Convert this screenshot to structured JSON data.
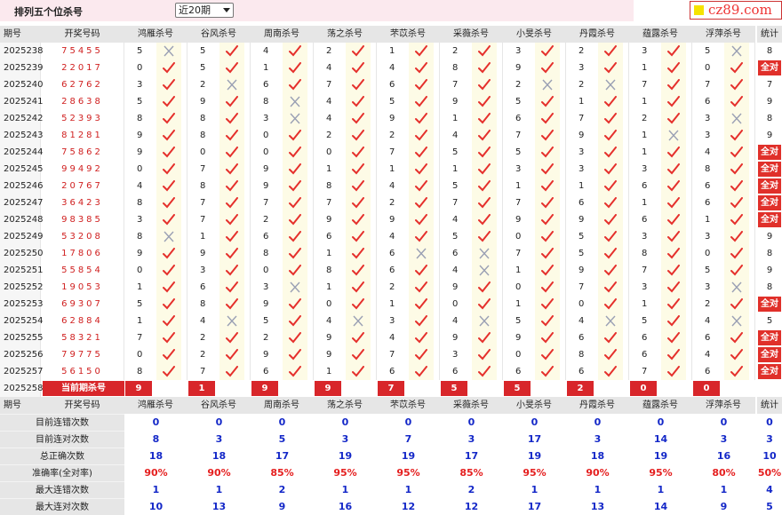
{
  "header": {
    "title": "排列五个位杀号",
    "period_select": "近20期",
    "logo": "cz89.com"
  },
  "columns": {
    "issue": "期号",
    "draw": "开奖号码",
    "killers": [
      "鸿雁杀号",
      "谷风杀号",
      "周南杀号",
      "荡之杀号",
      "芣苡杀号",
      "采薇杀号",
      "小旻杀号",
      "丹霞杀号",
      "蕴露杀号",
      "浮萍杀号"
    ],
    "stat": "统计"
  },
  "rows": [
    {
      "issue": "2025238",
      "draw": "75455",
      "picks": [
        "5",
        "5",
        "4",
        "2",
        "1",
        "2",
        "3",
        "2",
        "3",
        "5"
      ],
      "hits": [
        0,
        1,
        1,
        1,
        1,
        1,
        1,
        1,
        1,
        0
      ],
      "stat": "8"
    },
    {
      "issue": "2025239",
      "draw": "22017",
      "picks": [
        "0",
        "5",
        "1",
        "4",
        "4",
        "8",
        "9",
        "3",
        "1",
        "0"
      ],
      "hits": [
        1,
        1,
        1,
        1,
        1,
        1,
        1,
        1,
        1,
        1
      ],
      "stat": "全对"
    },
    {
      "issue": "2025240",
      "draw": "62762",
      "picks": [
        "3",
        "2",
        "6",
        "7",
        "6",
        "7",
        "2",
        "2",
        "7",
        "7"
      ],
      "hits": [
        1,
        0,
        1,
        1,
        1,
        1,
        0,
        0,
        1,
        1
      ],
      "stat": "7"
    },
    {
      "issue": "2025241",
      "draw": "28638",
      "picks": [
        "5",
        "9",
        "8",
        "4",
        "5",
        "9",
        "5",
        "1",
        "1",
        "6"
      ],
      "hits": [
        1,
        1,
        0,
        1,
        1,
        1,
        1,
        1,
        1,
        1
      ],
      "stat": "9"
    },
    {
      "issue": "2025242",
      "draw": "52393",
      "picks": [
        "8",
        "8",
        "3",
        "4",
        "9",
        "1",
        "6",
        "7",
        "2",
        "3"
      ],
      "hits": [
        1,
        1,
        0,
        1,
        1,
        1,
        1,
        1,
        1,
        0
      ],
      "stat": "8"
    },
    {
      "issue": "2025243",
      "draw": "81281",
      "picks": [
        "9",
        "8",
        "0",
        "2",
        "2",
        "4",
        "7",
        "9",
        "1",
        "3"
      ],
      "hits": [
        1,
        1,
        1,
        1,
        1,
        1,
        1,
        1,
        0,
        1
      ],
      "stat": "9"
    },
    {
      "issue": "2025244",
      "draw": "75862",
      "picks": [
        "9",
        "0",
        "0",
        "0",
        "7",
        "5",
        "5",
        "3",
        "1",
        "4"
      ],
      "hits": [
        1,
        1,
        1,
        1,
        1,
        1,
        1,
        1,
        1,
        1
      ],
      "stat": "全对"
    },
    {
      "issue": "2025245",
      "draw": "99492",
      "picks": [
        "0",
        "7",
        "9",
        "1",
        "1",
        "1",
        "3",
        "3",
        "3",
        "8"
      ],
      "hits": [
        1,
        1,
        1,
        1,
        1,
        1,
        1,
        1,
        1,
        1
      ],
      "stat": "全对"
    },
    {
      "issue": "2025246",
      "draw": "20767",
      "picks": [
        "4",
        "8",
        "9",
        "8",
        "4",
        "5",
        "1",
        "1",
        "6",
        "6"
      ],
      "hits": [
        1,
        1,
        1,
        1,
        1,
        1,
        1,
        1,
        1,
        1
      ],
      "stat": "全对"
    },
    {
      "issue": "2025247",
      "draw": "36423",
      "picks": [
        "8",
        "7",
        "7",
        "7",
        "2",
        "7",
        "7",
        "6",
        "1",
        "6"
      ],
      "hits": [
        1,
        1,
        1,
        1,
        1,
        1,
        1,
        1,
        1,
        1
      ],
      "stat": "全对"
    },
    {
      "issue": "2025248",
      "draw": "98385",
      "picks": [
        "3",
        "7",
        "2",
        "9",
        "9",
        "4",
        "9",
        "9",
        "6",
        "1"
      ],
      "hits": [
        1,
        1,
        1,
        1,
        1,
        1,
        1,
        1,
        1,
        1
      ],
      "stat": "全对"
    },
    {
      "issue": "2025249",
      "draw": "53208",
      "picks": [
        "8",
        "1",
        "6",
        "6",
        "4",
        "5",
        "0",
        "5",
        "3",
        "3"
      ],
      "hits": [
        0,
        1,
        1,
        1,
        1,
        1,
        1,
        1,
        1,
        1
      ],
      "stat": "9"
    },
    {
      "issue": "2025250",
      "draw": "17806",
      "picks": [
        "9",
        "9",
        "8",
        "1",
        "6",
        "6",
        "7",
        "5",
        "8",
        "0"
      ],
      "hits": [
        1,
        1,
        1,
        1,
        0,
        0,
        1,
        1,
        1,
        1
      ],
      "stat": "8"
    },
    {
      "issue": "2025251",
      "draw": "55854",
      "picks": [
        "0",
        "3",
        "0",
        "8",
        "6",
        "4",
        "1",
        "9",
        "7",
        "5"
      ],
      "hits": [
        1,
        1,
        1,
        1,
        1,
        0,
        1,
        1,
        1,
        1
      ],
      "stat": "9"
    },
    {
      "issue": "2025252",
      "draw": "19053",
      "picks": [
        "1",
        "6",
        "3",
        "1",
        "2",
        "9",
        "0",
        "7",
        "3",
        "3"
      ],
      "hits": [
        1,
        1,
        0,
        1,
        1,
        1,
        1,
        1,
        1,
        0
      ],
      "stat": "8"
    },
    {
      "issue": "2025253",
      "draw": "69307",
      "picks": [
        "5",
        "8",
        "9",
        "0",
        "1",
        "0",
        "1",
        "0",
        "1",
        "2"
      ],
      "hits": [
        1,
        1,
        1,
        1,
        1,
        1,
        1,
        1,
        1,
        1
      ],
      "stat": "全对"
    },
    {
      "issue": "2025254",
      "draw": "62884",
      "picks": [
        "1",
        "4",
        "5",
        "4",
        "3",
        "4",
        "5",
        "4",
        "5",
        "4"
      ],
      "hits": [
        1,
        0,
        1,
        0,
        1,
        0,
        1,
        0,
        1,
        0
      ],
      "stat": "5"
    },
    {
      "issue": "2025255",
      "draw": "58321",
      "picks": [
        "7",
        "2",
        "2",
        "9",
        "4",
        "9",
        "9",
        "6",
        "6",
        "6"
      ],
      "hits": [
        1,
        1,
        1,
        1,
        1,
        1,
        1,
        1,
        1,
        1
      ],
      "stat": "全对"
    },
    {
      "issue": "2025256",
      "draw": "79775",
      "picks": [
        "0",
        "2",
        "9",
        "9",
        "7",
        "3",
        "0",
        "8",
        "6",
        "4"
      ],
      "hits": [
        1,
        1,
        1,
        1,
        1,
        1,
        1,
        1,
        1,
        1
      ],
      "stat": "全对"
    },
    {
      "issue": "2025257",
      "draw": "56150",
      "picks": [
        "8",
        "7",
        "6",
        "1",
        "6",
        "6",
        "6",
        "6",
        "7",
        "6"
      ],
      "hits": [
        1,
        1,
        1,
        1,
        1,
        1,
        1,
        1,
        1,
        1
      ],
      "stat": "全对"
    }
  ],
  "current": {
    "issue": "2025258",
    "label": "当前期杀号",
    "picks": [
      "9",
      "1",
      "9",
      "9",
      "7",
      "5",
      "5",
      "2",
      "0",
      "0"
    ]
  },
  "stats": {
    "labels": [
      "目前连错次数",
      "目前连对次数",
      "总正确次数",
      "准确率(全对率)",
      "最大连错次数",
      "最大连对次数"
    ],
    "values": [
      [
        "0",
        "0",
        "0",
        "0",
        "0",
        "0",
        "0",
        "0",
        "0",
        "0",
        "0"
      ],
      [
        "8",
        "3",
        "5",
        "3",
        "7",
        "3",
        "17",
        "3",
        "14",
        "3",
        "3"
      ],
      [
        "18",
        "18",
        "17",
        "19",
        "19",
        "17",
        "19",
        "18",
        "19",
        "16",
        "10"
      ],
      [
        "90%",
        "90%",
        "85%",
        "95%",
        "95%",
        "85%",
        "95%",
        "90%",
        "95%",
        "80%",
        "50%"
      ],
      [
        "1",
        "1",
        "2",
        "1",
        "1",
        "2",
        "1",
        "1",
        "1",
        "1",
        "4"
      ],
      [
        "10",
        "13",
        "9",
        "16",
        "12",
        "12",
        "17",
        "13",
        "14",
        "9",
        "5"
      ]
    ]
  }
}
